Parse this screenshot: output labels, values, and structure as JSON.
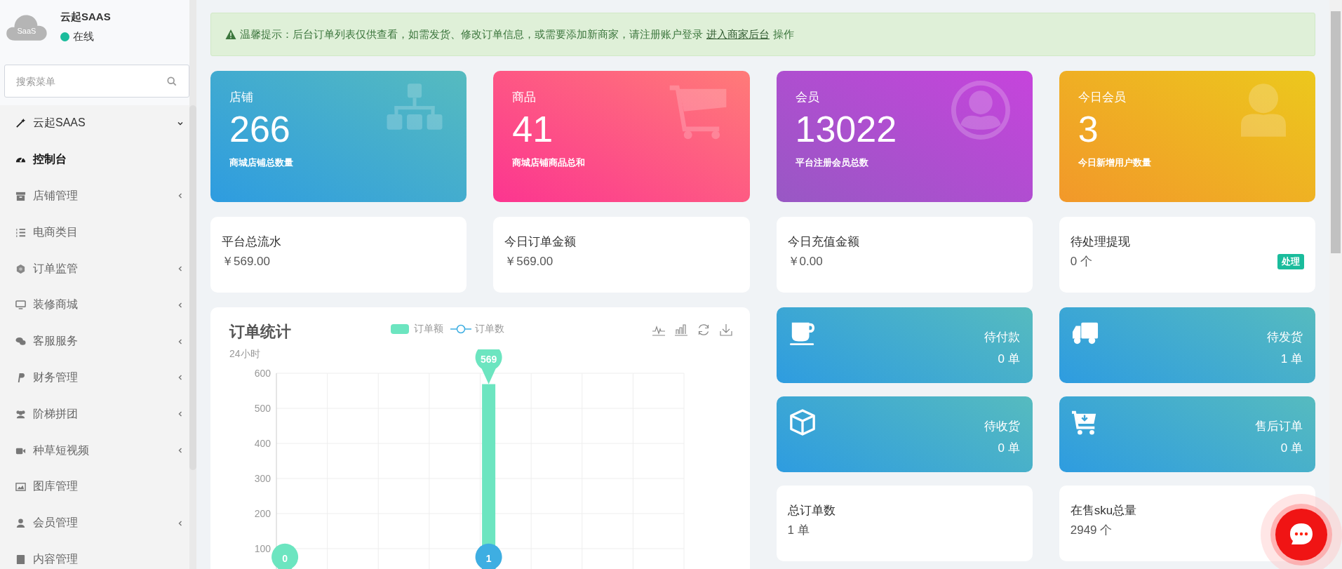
{
  "sidebar": {
    "brand": {
      "logo_text": "SaaS",
      "name": "云起SAAS",
      "status": "在线"
    },
    "search": {
      "placeholder": "搜索菜单"
    },
    "items": [
      {
        "label": "云起SAAS",
        "kind": "group",
        "expanded": true,
        "selected": false
      },
      {
        "label": "控制台",
        "kind": "link",
        "selected": true
      },
      {
        "label": "店铺管理",
        "kind": "group",
        "expanded": false,
        "selected": false
      },
      {
        "label": "电商类目",
        "kind": "link",
        "selected": false
      },
      {
        "label": "订单监管",
        "kind": "group",
        "expanded": false,
        "selected": false
      },
      {
        "label": "装修商城",
        "kind": "group",
        "expanded": false,
        "selected": false
      },
      {
        "label": "客服服务",
        "kind": "group",
        "expanded": false,
        "selected": false
      },
      {
        "label": "财务管理",
        "kind": "group",
        "expanded": false,
        "selected": false
      },
      {
        "label": "阶梯拼团",
        "kind": "group",
        "expanded": false,
        "selected": false
      },
      {
        "label": "种草短视频",
        "kind": "group",
        "expanded": false,
        "selected": false
      },
      {
        "label": "图库管理",
        "kind": "link",
        "selected": false
      },
      {
        "label": "会员管理",
        "kind": "group",
        "expanded": false,
        "selected": false
      },
      {
        "label": "内容管理",
        "kind": "link"
      }
    ]
  },
  "notice": {
    "text": "温馨提示：后台订单列表仅供查看，如需发货、修改订单信息，或需要添加新商家，请注册账户登录",
    "link": "进入商家后台",
    "suffix": "操作"
  },
  "stat_cards": [
    {
      "title": "店铺",
      "value": "266",
      "caption": "商城店铺总数量"
    },
    {
      "title": "商品",
      "value": "41",
      "caption": "商城店铺商品总和"
    },
    {
      "title": "会员",
      "value": "13022",
      "caption": "平台注册会员总数"
    },
    {
      "title": "今日会员",
      "value": "3",
      "caption": "今日新增用户数量"
    }
  ],
  "summary_cards": [
    {
      "title": "平台总流水",
      "value": "￥569.00"
    },
    {
      "title": "今日订单金额",
      "value": "￥569.00"
    },
    {
      "title": "今日充值金额",
      "value": "￥0.00"
    },
    {
      "title": "待处理提现",
      "value": "0 个",
      "action": "处理"
    }
  ],
  "order_chart": {
    "title": "订单统计",
    "subtitle": "24小时",
    "legend": [
      {
        "name": "订单额",
        "kind": "bar",
        "color": "#6ce5c0"
      },
      {
        "name": "订单数",
        "kind": "line",
        "color": "#3eaee2"
      }
    ],
    "y_axis_labels": [
      "600",
      "500",
      "400",
      "300",
      "200",
      "100"
    ],
    "markers": [
      {
        "label": "569",
        "kind": "bar-top",
        "color": "#6ce5c0"
      },
      {
        "label": "0",
        "kind": "bar-base",
        "color": "#6ce5c0"
      },
      {
        "label": "1",
        "kind": "line-base",
        "color": "#3eaee2"
      }
    ]
  },
  "order_status_cards": [
    {
      "label": "待付款",
      "value": "0 单"
    },
    {
      "label": "待发货",
      "value": "1 单"
    },
    {
      "label": "待收货",
      "value": "0 单"
    },
    {
      "label": "售后订单",
      "value": "0 单"
    }
  ],
  "totals_cards": [
    {
      "title": "总订单数",
      "value": "1 单"
    },
    {
      "title": "在售sku总量",
      "value": "2949 个"
    }
  ]
}
